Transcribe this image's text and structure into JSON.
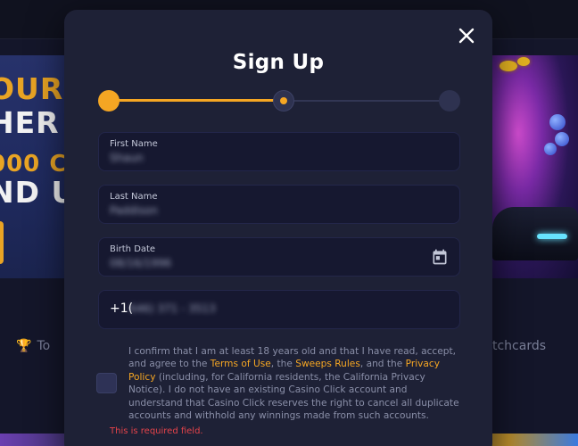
{
  "background": {
    "banner_lines": [
      "OURS",
      "HER",
      "000 C",
      "ND U"
    ],
    "tab_left_label": "To",
    "tab_right_label": "tchcards"
  },
  "modal": {
    "title": "Sign Up",
    "close_icon": "close-icon",
    "stepper": {
      "steps_total": 3,
      "current_step": 2,
      "progress_fraction": 0.5,
      "accent_color": "#f5a623"
    },
    "fields": {
      "first_name": {
        "label": "First Name",
        "value": "Shaun"
      },
      "last_name": {
        "label": "Last Name",
        "value": "Paddison"
      },
      "birth_date": {
        "label": "Birth Date",
        "value": "08/16/1996",
        "icon": "calendar-icon"
      },
      "phone": {
        "prefix": "+1(",
        "value": "646) 371 - 3513"
      }
    },
    "consent": {
      "text_1": "I confirm that I am at least 18 years old and that I have read, accept, and agree to the ",
      "terms_link": "Terms of Use",
      "text_2": ", the ",
      "sweeps_link": "Sweeps Rules",
      "text_3": ", and the ",
      "privacy_link": "Privacy Policy",
      "text_4": " (including, for California residents, the California Privacy Notice). I do not have an existing Casino Click account and understand that Casino Click reserves the right to cancel all duplicate accounts and withhold any winnings made from such accounts.",
      "checked": false
    },
    "error": "This is required field."
  },
  "colors": {
    "accent": "#f5a623",
    "modal_bg": "#1e2136",
    "field_bg": "#161830",
    "error": "#e5434a"
  }
}
